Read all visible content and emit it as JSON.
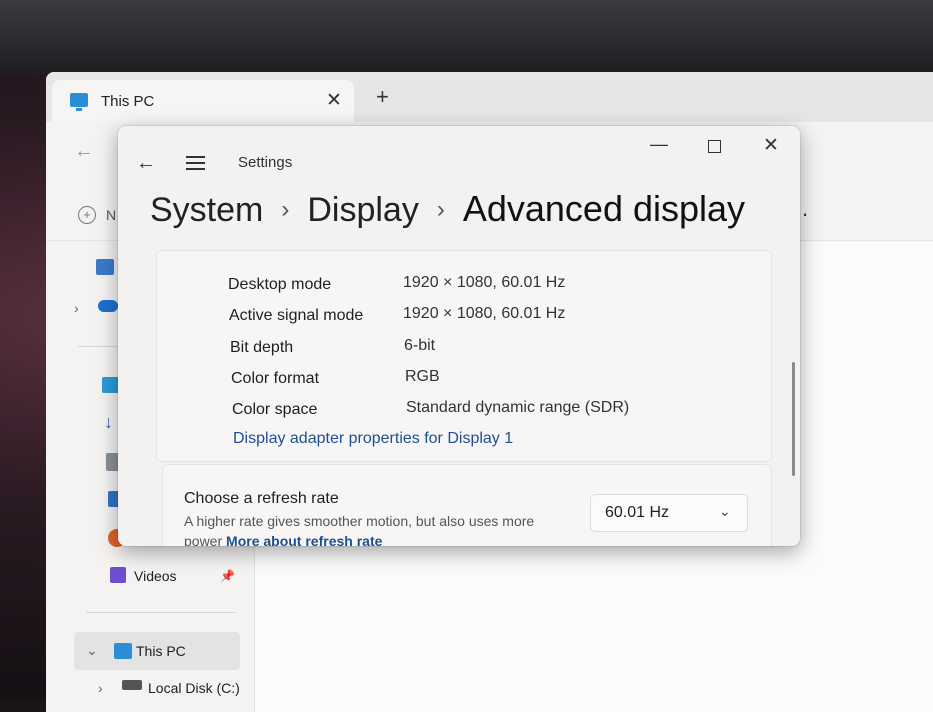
{
  "explorer": {
    "tab_title": "This PC",
    "tab_close": "✕",
    "new_tab": "+",
    "back": "←",
    "new_label": "N",
    "sidebar": {
      "videos_label": "Videos",
      "this_pc_label": "This PC",
      "local_disk_label": "Local Disk (C:)",
      "pin": "📌",
      "chevron_right": "›",
      "chevron_down": "⌄"
    }
  },
  "settings": {
    "window_title": "Settings",
    "back": "←",
    "minimize": "—",
    "close": "✕",
    "breadcrumb": {
      "item1": "System",
      "item2": "Display",
      "current": "Advanced display",
      "separator": "›"
    },
    "display_info": {
      "rows": [
        {
          "label": "Desktop mode",
          "value": "1920 × 1080, 60.01 Hz"
        },
        {
          "label": "Active signal mode",
          "value": "1920 × 1080, 60.01 Hz"
        },
        {
          "label": "Bit depth",
          "value": "6-bit"
        },
        {
          "label": "Color format",
          "value": "RGB"
        },
        {
          "label": "Color space",
          "value": "Standard dynamic range (SDR)"
        }
      ],
      "link": "Display adapter properties for Display 1"
    },
    "refresh_rate": {
      "title": "Choose a refresh rate",
      "description": "A higher rate gives smoother motion, but also uses more power",
      "link": "More about refresh rate",
      "selected": "60.01 Hz",
      "chevron": "⌄"
    }
  },
  "colors": {
    "accent_link": "#1f4f8f",
    "folder_blue": "#2b8fd6"
  }
}
